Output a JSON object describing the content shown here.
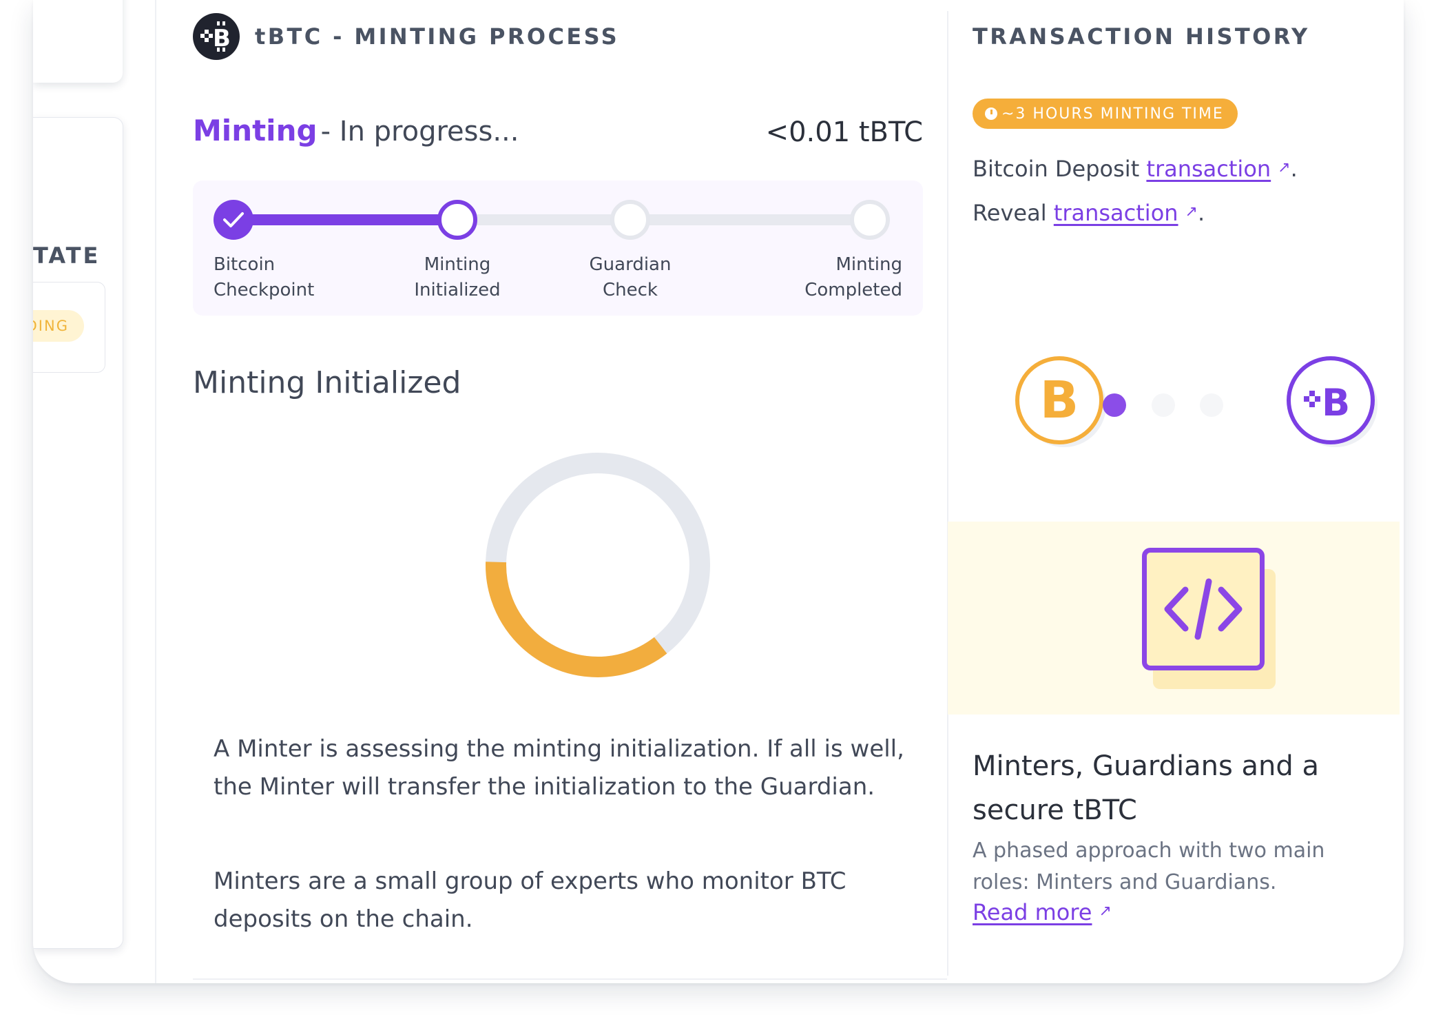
{
  "left_panel": {
    "state_label": "STATE",
    "pill_label": "PENDING"
  },
  "header": {
    "title": "tBTC - MINTING PROCESS",
    "logo_glyph": "B"
  },
  "status": {
    "word": "Minting",
    "rest": "- In progress...",
    "amount": "<0.01 tBTC"
  },
  "steps": [
    {
      "line1": "Bitcoin",
      "line2": "Checkpoint",
      "state": "done"
    },
    {
      "line1": "Minting",
      "line2": "Initialized",
      "state": "current"
    },
    {
      "line1": "Guardian",
      "line2": "Check",
      "state": "todo"
    },
    {
      "line1": "Minting",
      "line2": "Completed",
      "state": "todo"
    }
  ],
  "section": {
    "title": "Minting Initialized",
    "progress_fraction": 0.36,
    "desc1": "A Minter is assessing the minting initialization. If all is well, the Minter will transfer the initialization to the Guardian.",
    "desc2": "Minters are a small group of experts who monitor BTC deposits on the chain."
  },
  "transaction_history": {
    "title": "TRANSACTION HISTORY",
    "badge": "~3 HOURS MINTING TIME",
    "deposit_prefix": "Bitcoin Deposit ",
    "deposit_link": "transaction",
    "reveal_prefix": "Reveal ",
    "reveal_link": "transaction",
    "period": ".",
    "arrow": "↗"
  },
  "coins": {
    "btc_glyph": "B",
    "tbtc_glyph": "B"
  },
  "promo": {
    "title": "Minters, Guardians and a secure tBTC",
    "text": "A phased approach with two main roles: Minters and Guardians.",
    "link": "Read more",
    "arrow": "↗"
  },
  "colors": {
    "accent": "#7b3fe4",
    "orange": "#f5ae3a",
    "track": "#e7e9ef"
  }
}
